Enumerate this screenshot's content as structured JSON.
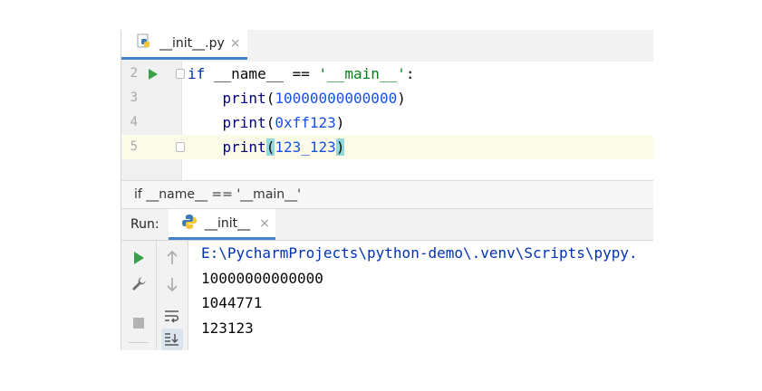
{
  "editor_tab": {
    "filename": "__init__.py",
    "close": "×"
  },
  "editor": {
    "lines": [
      {
        "num": "2",
        "kw": "if",
        "mid": " __name__ == ",
        "str": "'__main__'",
        "end": ":"
      },
      {
        "num": "3",
        "fn": "print",
        "open": "(",
        "arg": "10000000000000",
        "close": ")"
      },
      {
        "num": "4",
        "fn": "print",
        "open": "(",
        "arg": "0xff123",
        "close": ")"
      },
      {
        "num": "5",
        "fn": "print",
        "open": "(",
        "arg": "123_123",
        "close": ")"
      }
    ]
  },
  "breadcrumb": "if __name__ == '__main__'",
  "run_panel": {
    "label": "Run:",
    "tab": {
      "name": "__init__",
      "close": "×"
    },
    "output": [
      "E:\\PycharmProjects\\python-demo\\.venv\\Scripts\\pypy.",
      "10000000000000",
      "1044771",
      "123123"
    ]
  },
  "colors": {
    "accent": "#4083c9",
    "run_green": "#3aa04a",
    "keyword": "#0033b3",
    "string": "#067d17",
    "number": "#1750eb",
    "bracket_highlight": "#93d9d9"
  }
}
